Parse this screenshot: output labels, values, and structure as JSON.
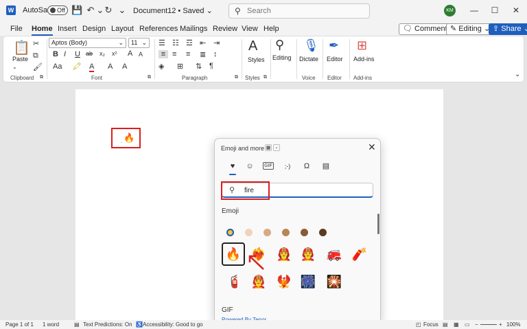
{
  "titlebar": {
    "app_logo": "W",
    "autosave_label": "AutoSave",
    "autosave_state": "Off",
    "doc_title": "Document12 • Saved ⌄",
    "search_placeholder": "Search",
    "avatar_initials": "KM",
    "icons": {
      "save": "save-icon",
      "undo": "undo-icon",
      "redo": "redo-icon",
      "customize": "customize-icon"
    }
  },
  "menu": {
    "items": [
      "File",
      "Home",
      "Insert",
      "Design",
      "Layout",
      "References",
      "Mailings",
      "Review",
      "View",
      "Help"
    ],
    "active": "Home",
    "comments_label": "Comments",
    "editing_label": "Editing ⌄",
    "share_label": "Share ⌄"
  },
  "ribbon": {
    "font_name": "Aptos (Body)",
    "font_size": "11",
    "paste_label": "Paste",
    "styles_label": "Styles",
    "editing_label": "Editing",
    "dictate_label": "Dictate",
    "editor_label": "Editor",
    "addins_label": "Add-ins",
    "groups": {
      "clipboard": "Clipboard",
      "font": "Font",
      "paragraph": "Paragraph",
      "styles": "Styles",
      "voice": "Voice",
      "editor": "Editor",
      "addins": "Add-ins"
    },
    "font_buttons": [
      "B",
      "I",
      "U",
      "ab",
      "x₂",
      "x²",
      "A",
      "A",
      "Aa",
      "A",
      "A",
      "A"
    ]
  },
  "document": {
    "inserted_emoji": "🔥"
  },
  "emoji_panel": {
    "title": "Emoji and more",
    "close": "✕",
    "tabs": [
      "♥",
      "☺",
      "GIF",
      ";-)",
      "Ω",
      "▤"
    ],
    "search_value": "fire",
    "section_emoji": "Emoji",
    "skin_tones": [
      "#f4c430",
      "#f2d3b7",
      "#d9a982",
      "#b88656",
      "#8a5a35",
      "#5b3a25"
    ],
    "row1": [
      "🔥",
      "❤️‍🔥",
      "👩‍🚒",
      "🧑‍🚒",
      "🚒",
      "🧨"
    ],
    "row2": [
      "🧯",
      "👨‍🚒",
      "🐦‍🔥",
      "🎆",
      "🎇"
    ],
    "section_gif": "GIF",
    "gif_credit": "Powered By Tenor"
  },
  "status": {
    "page": "Page 1 of 1",
    "words": "1 word",
    "predictions": "Text Predictions: On",
    "accessibility": "Accessibility: Good to go",
    "focus": "Focus",
    "zoom": "100%"
  }
}
